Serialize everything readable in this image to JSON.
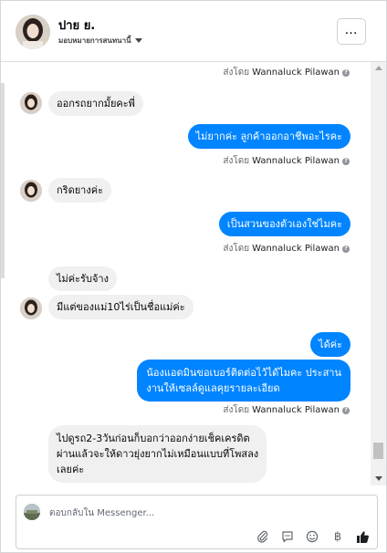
{
  "header": {
    "name": "ปาย ย.",
    "subtitle": "มอบหมายการสนทนานี้"
  },
  "sent_by": {
    "prefix": "ส่งโดย",
    "name": "Wannaluck Pilawan"
  },
  "messages": [
    {
      "text": "ออกรถยากมั้ยคะพี่"
    },
    {
      "text": "ไม่ยากค่ะ ลูกค้าออกอาชีพอะไรคะ"
    },
    {
      "text": "กริดยางค่ะ"
    },
    {
      "text": "เป็นสวนของตัวเองใช่ไมคะ"
    },
    {
      "text": "ไม่ค่ะรับจ้าง"
    },
    {
      "text": "มีแต่ของแม่10ไร่เป็นชื่อแม่ค่ะ"
    },
    {
      "text": "ได้ค่ะ"
    },
    {
      "lines": [
        "น้องแอดมินขอเบอร์ติดต่อไว้ได้ไมคะ ประสาน",
        "งานให้เซลล์ดูแลคุยรายละเอียด"
      ]
    },
    {
      "lines": [
        "ไปดูรถ2-3วันก่อนก็บอกว่าออกง่ายเช็คเครดิต",
        "ผ่านแล้วจะให้ดาวยุ่งยากไม่เหมือนแบบที่โพสลง",
        "เลยค่ะ"
      ]
    }
  ],
  "composer": {
    "placeholder": "ตอบกลับใน Messenger..."
  },
  "colors": {
    "outgoing_bubble": "#0084ff",
    "incoming_bubble": "#f0f0f0",
    "like_icon": "#1c1e21"
  },
  "icons": [
    "more-options-icon",
    "dropdown-caret-icon",
    "info-icon",
    "attachment-icon",
    "gif-icon",
    "emoji-icon",
    "baht-icon",
    "like-icon"
  ]
}
